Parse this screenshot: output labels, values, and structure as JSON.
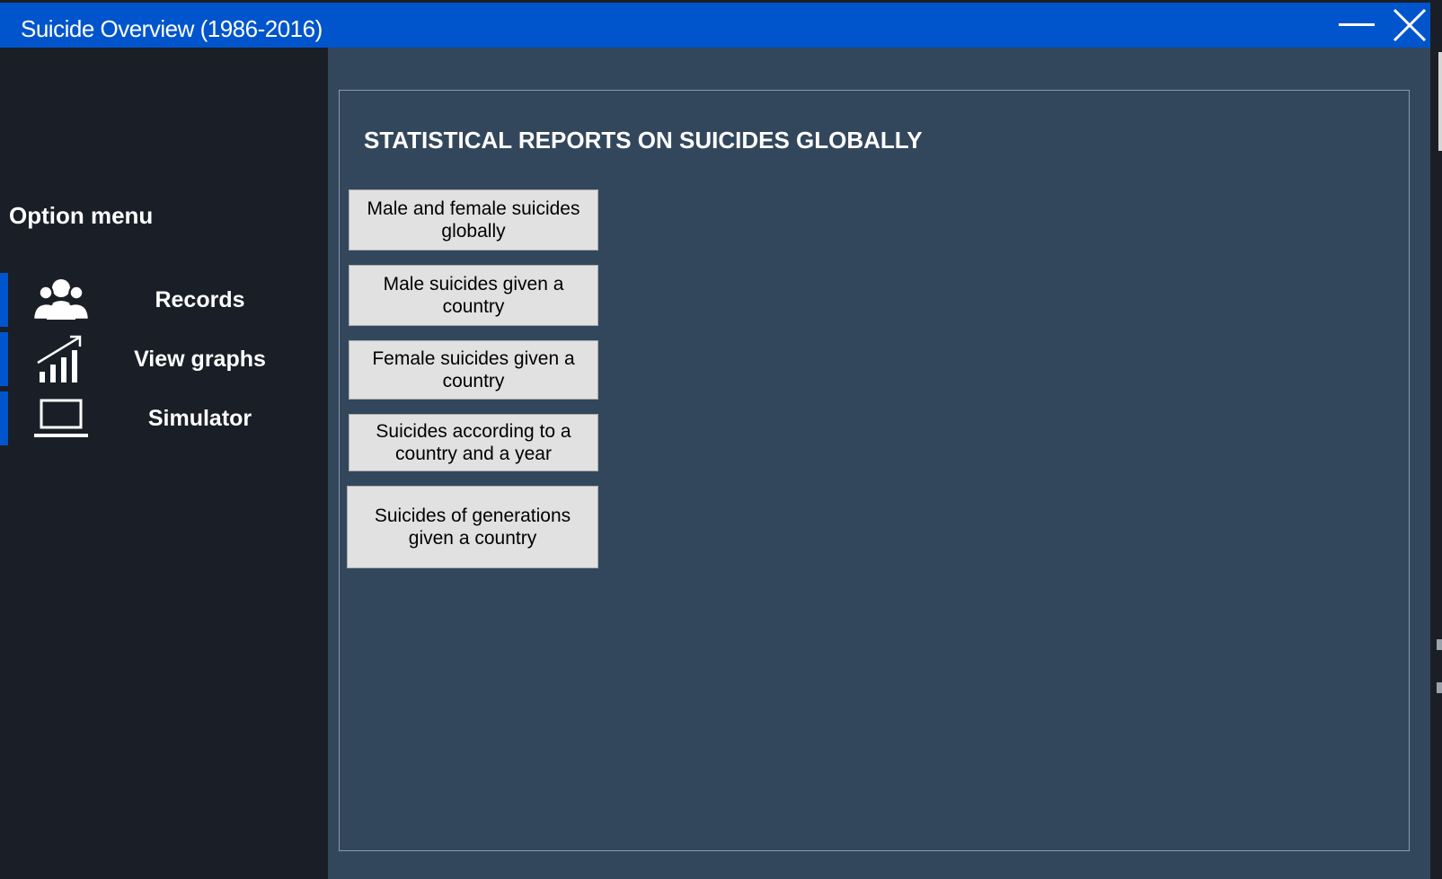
{
  "window": {
    "title": "Suicide Overview (1986-2016)",
    "controls": [
      "minimize-icon",
      "close-icon"
    ],
    "accent_color": "#0055cc"
  },
  "sidebar": {
    "menu_title": "Option menu",
    "items": [
      {
        "label": "Records",
        "icon": "users-icon"
      },
      {
        "label": "View graphs",
        "icon": "chart-icon"
      },
      {
        "label": "Simulator",
        "icon": "laptop-icon"
      }
    ]
  },
  "main": {
    "title": "STATISTICAL REPORTS ON SUICIDES GLOBALLY",
    "buttons": [
      {
        "label": "Male and female suicides globally"
      },
      {
        "label": "Male suicides given a country"
      },
      {
        "label": "Female suicides given a country"
      },
      {
        "label": "Suicides according to a country and a year"
      },
      {
        "label": "Suicides of generations given a country"
      }
    ]
  }
}
